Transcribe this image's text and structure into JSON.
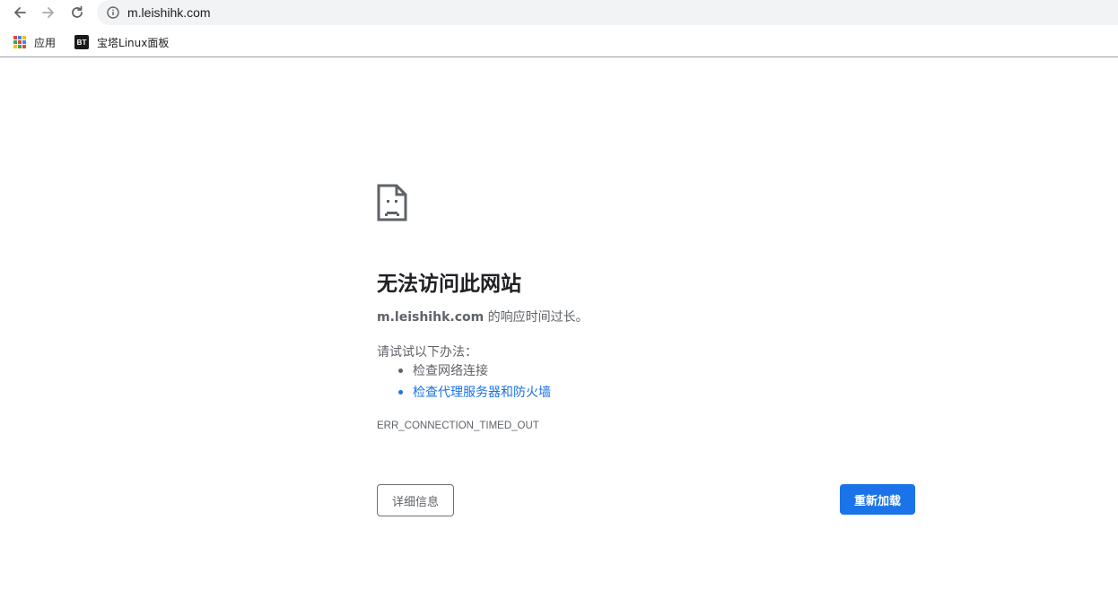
{
  "toolbar": {
    "url": "m.leishihk.com"
  },
  "bookmarks": {
    "apps_label": "应用",
    "bt_icon_text": "BT",
    "bt_label": "宝塔Linux面板"
  },
  "error": {
    "heading": "无法访问此网站",
    "host": "m.leishihk.com",
    "desc_suffix": " 的响应时间过长。",
    "suggest_title": "请试试以下办法：",
    "suggestions": [
      "检查网络连接",
      "检查代理服务器和防火墙"
    ],
    "code": "ERR_CONNECTION_TIMED_OUT",
    "details_button": "详细信息",
    "reload_button": "重新加载"
  },
  "colors": {
    "accent": "#1a73e8",
    "text_primary": "#202124",
    "text_secondary": "#5f6368"
  }
}
